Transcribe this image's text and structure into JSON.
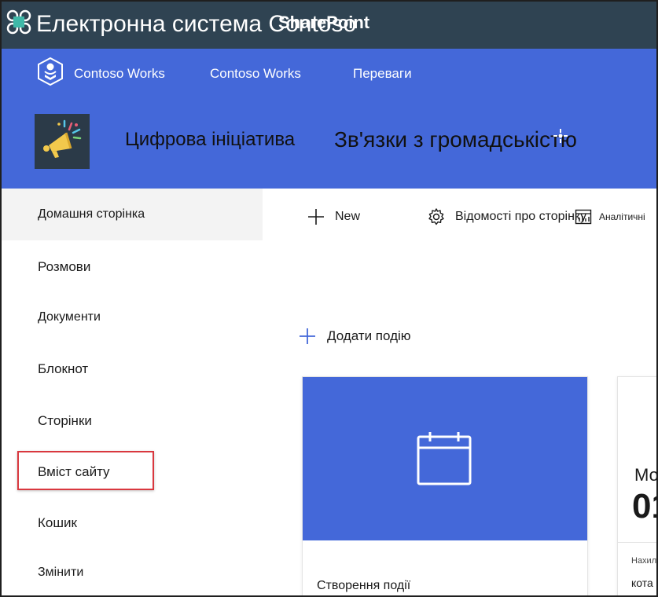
{
  "suite_bar": {
    "title": "Електронна система Contoso",
    "brand": "SharePoint",
    "icon": "app-launcher-icon"
  },
  "hub_nav": {
    "logo_icon": "hub-logo-icon",
    "links": [
      "Contoso Works",
      "Contoso Works",
      "Переваги"
    ]
  },
  "site_header": {
    "site_name": "Цифрова ініціатива",
    "page_name": "Зв'язки з громадськістю",
    "logo_icon": "megaphone-icon"
  },
  "left_nav": {
    "items": [
      "Домашня сторінка",
      "Розмови",
      "Документи",
      "Блокнот",
      "Сторінки",
      "Вміст сайту",
      "Кошик",
      "Змінити"
    ],
    "selected_index": 0,
    "highlighted_index": 5
  },
  "command_bar": {
    "new_label": "New",
    "page_details_label": "Відомості про сторінку",
    "analytics_label": "Аналітичні"
  },
  "events": {
    "add_event_label": "Додати подію",
    "card_title": "Створення  події",
    "partial_card": {
      "month": "Мо",
      "day": "01",
      "upcoming": "Нахил",
      "title": "кота"
    }
  },
  "colors": {
    "suite_bar": "#2f4352",
    "brand_blue": "#4468d9",
    "highlight_red": "#d9383f"
  }
}
